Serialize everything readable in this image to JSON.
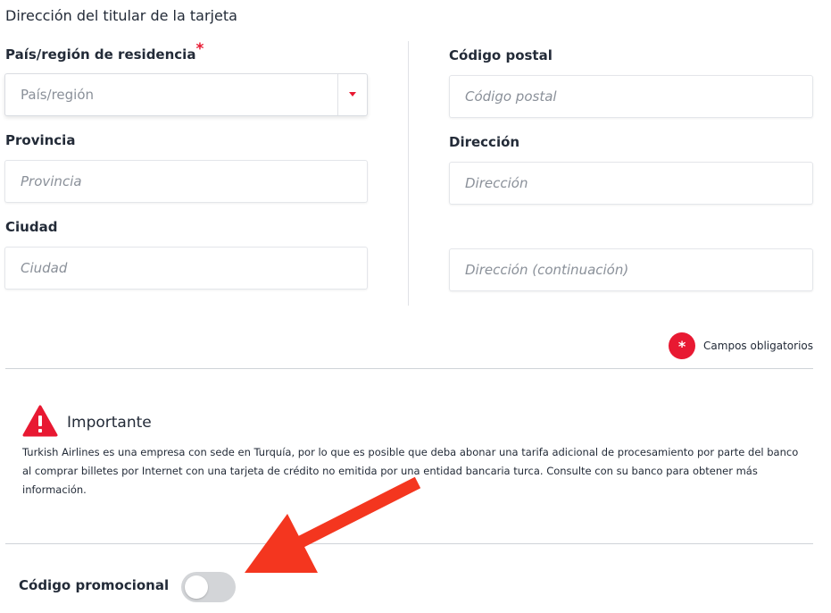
{
  "section": {
    "title": "Dirección del titular de la tarjeta"
  },
  "left": {
    "country_label": "País/región de residencia",
    "required_marker": "*",
    "country_placeholder": "País/región",
    "province_label": "Provincia",
    "province_placeholder": "Provincia",
    "city_label": "Ciudad",
    "city_placeholder": "Ciudad"
  },
  "right": {
    "postal_label": "Código postal",
    "postal_placeholder": "Código postal",
    "address_label": "Dirección",
    "address_placeholder": "Dirección",
    "address2_placeholder": "Dirección (continuación)"
  },
  "required_note": {
    "icon_text": "*",
    "label": "Campos obligatorios"
  },
  "notice": {
    "title": "Importante",
    "text": "Turkish Airlines es una empresa con sede en Turquía, por lo que es posible que deba abonar una tarifa adicional de procesamiento por parte del banco al comprar billetes por Internet con una tarjeta de crédito no emitida por una entidad bancaria turca. Consulte con su banco para obtener más información."
  },
  "promo": {
    "label": "Código promocional",
    "toggle_on": false
  },
  "colors": {
    "accent": "#e81932",
    "annotation_arrow": "#f4361f",
    "toggle_off": "#d3d5d8"
  }
}
